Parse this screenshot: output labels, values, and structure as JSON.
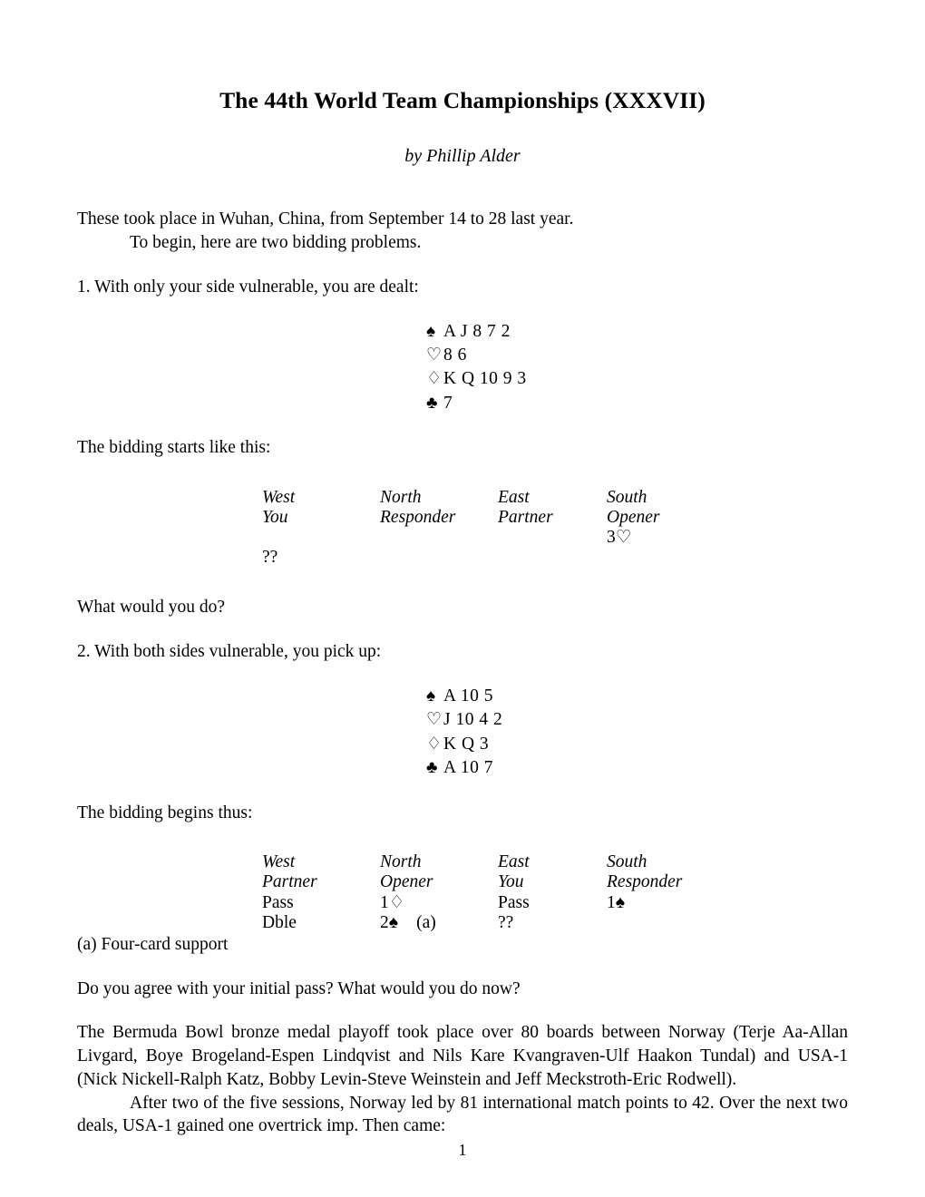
{
  "document": {
    "title": "The 44th World Team Championships (XXXVII)",
    "byline": "by Phillip Alder",
    "page_number": "1"
  },
  "intro": {
    "line1": "These took place in Wuhan, China, from September 14 to 28 last year.",
    "line2": "To begin, here are two bidding problems."
  },
  "problem1": {
    "prompt": "1. With only your side vulnerable, you are dealt:",
    "hand": {
      "spades_symbol": "spade-suit-icon",
      "spades": "A J 8 7 2",
      "hearts_symbol": "heart-suit-icon",
      "hearts": "8 6",
      "diamonds_symbol": "diamond-suit-icon",
      "diamonds": "K Q 10 9 3",
      "clubs_symbol": "club-suit-icon",
      "clubs": "7"
    },
    "lead_in": "The bidding starts like this:",
    "auction": {
      "headers": [
        "West",
        "North",
        "East",
        "South"
      ],
      "roles": [
        "You",
        "Responder",
        "Partner",
        "Opener"
      ],
      "rows": [
        [
          "",
          "",
          "",
          "3♡"
        ],
        [
          "??",
          "",
          "",
          ""
        ]
      ]
    },
    "question": "What would you do?"
  },
  "problem2": {
    "prompt": "2. With both sides vulnerable, you pick up:",
    "hand": {
      "spades_symbol": "spade-suit-icon",
      "spades": "A 10 5",
      "hearts_symbol": "heart-suit-icon",
      "hearts": "J 10 4 2",
      "diamonds_symbol": "diamond-suit-icon",
      "diamonds": "K Q 3",
      "clubs_symbol": "club-suit-icon",
      "clubs": "A 10 7"
    },
    "lead_in": "The bidding begins thus:",
    "auction": {
      "headers": [
        "West",
        "North",
        "East",
        "South"
      ],
      "roles": [
        "Partner",
        "Opener",
        "You",
        "Responder"
      ],
      "rows": [
        [
          "Pass",
          "1♢",
          "Pass",
          "1♠"
        ],
        [
          "Dble",
          "2♠",
          "??",
          ""
        ]
      ],
      "note_marker": "(a)"
    },
    "footnote": "(a) Four-card support",
    "question": "Do you agree with your initial pass? What would you do now?"
  },
  "body": {
    "para1": "The Bermuda Bowl bronze medal playoff took place over 80 boards between Norway (Terje Aa-Allan Livgard, Boye Brogeland-Espen Lindqvist and Nils Kare Kvangraven-Ulf Haakon Tundal) and USA-1 (Nick Nickell-Ralph Katz, Bobby Levin-Steve Weinstein and Jeff Meckstroth-Eric Rodwell).",
    "para2": "After two of the five sessions, Norway led by 81 international match points to 42. Over the next two deals, USA-1 gained one overtrick imp. Then came:"
  }
}
